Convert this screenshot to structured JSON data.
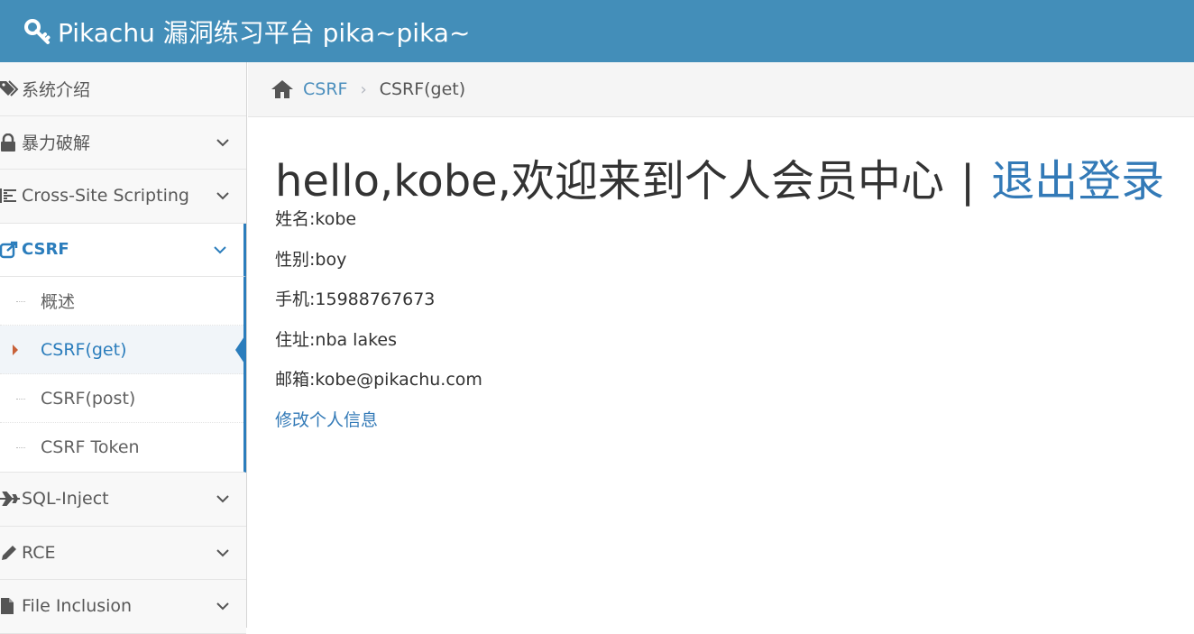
{
  "app": {
    "title": "Pikachu 漏洞练习平台 pika~pika~",
    "brand_icon": "key-icon",
    "accent_color": "#438eb9"
  },
  "sidebar": {
    "items": [
      {
        "label": "系统介绍",
        "icon": "tags-icon",
        "expandable": false
      },
      {
        "label": "暴力破解",
        "icon": "lock-icon",
        "expandable": true
      },
      {
        "label": "Cross-Site Scripting",
        "icon": "list-icon",
        "expandable": true
      },
      {
        "label": "CSRF",
        "icon": "share-icon",
        "expandable": true,
        "active": true
      }
    ],
    "csrf_sub": [
      {
        "label": "概述"
      },
      {
        "label": "CSRF(get)",
        "current": true
      },
      {
        "label": "CSRF(post)"
      },
      {
        "label": "CSRF Token"
      }
    ],
    "items_after": [
      {
        "label": "SQL-Inject",
        "icon": "plane-icon",
        "expandable": true
      },
      {
        "label": "RCE",
        "icon": "pencil-icon",
        "expandable": true
      },
      {
        "label": "File Inclusion",
        "icon": "file-icon",
        "expandable": true
      }
    ]
  },
  "breadcrumb": {
    "link": "CSRF",
    "current": "CSRF(get)"
  },
  "main": {
    "greeting": "hello,kobe,欢迎来到个人会员中心",
    "separator": "|",
    "logout": "退出登录",
    "info": [
      "姓名:kobe",
      "性别:boy",
      "手机:15988767673",
      "住址:nba lakes",
      "邮箱:kobe@pikachu.com"
    ],
    "edit_link": "修改个人信息"
  }
}
